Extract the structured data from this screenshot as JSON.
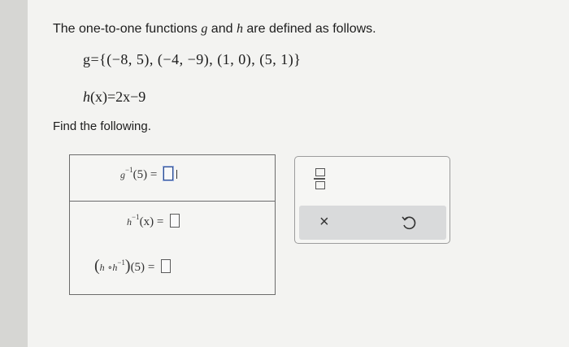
{
  "problem": {
    "intro_before": "The one-to-one functions ",
    "g": "g",
    "and": " and ",
    "h": "h",
    "intro_after": " are defined as follows.",
    "g_definition": "g={(−8, 5), (−4, −9), (1, 0), (5, 1)}",
    "h_name": "h",
    "h_arg": "(x)",
    "h_rhs": "=2x−9",
    "find_label": "Find the following."
  },
  "answers": [
    {
      "fn": "g",
      "sup": "−1",
      "arg": "(5)",
      "equals": "=",
      "value": ""
    },
    {
      "fn": "h",
      "sup": "−1",
      "arg": "(x)",
      "equals": "=",
      "value": ""
    },
    {
      "open": "(",
      "f1": "h",
      "compose": "∘",
      "f2": "h",
      "sup": "−1",
      "close": ")",
      "arg": "(5)",
      "equals": "=",
      "value": ""
    }
  ],
  "toolbar": {
    "clear_symbol": "×"
  },
  "icons": [
    "fraction-icon",
    "close-icon",
    "undo-icon"
  ]
}
